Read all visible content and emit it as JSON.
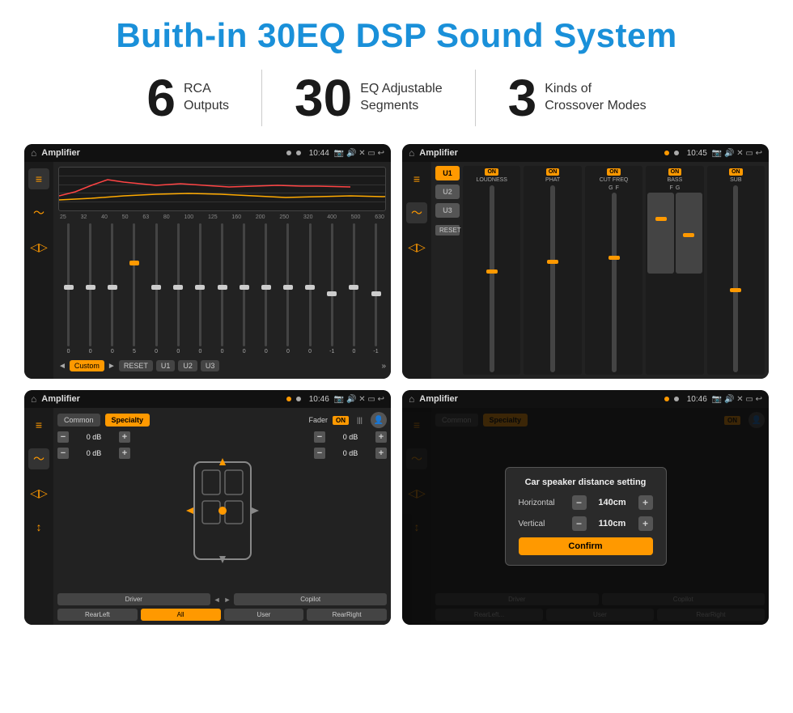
{
  "title": "Buith-in 30EQ DSP Sound System",
  "stats": [
    {
      "number": "6",
      "desc_line1": "RCA",
      "desc_line2": "Outputs"
    },
    {
      "number": "30",
      "desc_line1": "EQ Adjustable",
      "desc_line2": "Segments"
    },
    {
      "number": "3",
      "desc_line1": "Kinds of",
      "desc_line2": "Crossover Modes"
    }
  ],
  "screens": [
    {
      "id": "screen-eq",
      "app": "Amplifier",
      "time": "10:44",
      "eq": {
        "freqs": [
          "25",
          "32",
          "40",
          "50",
          "63",
          "80",
          "100",
          "125",
          "160",
          "200",
          "250",
          "320",
          "400",
          "500",
          "630"
        ],
        "values": [
          "0",
          "0",
          "0",
          "5",
          "0",
          "0",
          "0",
          "0",
          "0",
          "0",
          "0",
          "0",
          "-1",
          "0",
          "-1"
        ],
        "preset": "Custom",
        "buttons": [
          "RESET",
          "U1",
          "U2",
          "U3"
        ]
      }
    },
    {
      "id": "screen-amp",
      "app": "Amplifier",
      "time": "10:45",
      "channels": [
        "LOUDNESS",
        "PHAT",
        "CUT FREQ",
        "BASS",
        "SUB"
      ],
      "u_buttons": [
        "U1",
        "U2",
        "U3"
      ]
    },
    {
      "id": "screen-fader",
      "app": "Amplifier",
      "time": "10:46",
      "tabs": [
        "Common",
        "Specialty"
      ],
      "fader_label": "Fader",
      "db_values": [
        "0 dB",
        "0 dB",
        "0 dB",
        "0 dB"
      ],
      "bottom_buttons": [
        "Driver",
        "Copilot",
        "RearLeft",
        "All",
        "User",
        "RearRight"
      ]
    },
    {
      "id": "screen-dialog",
      "app": "Amplifier",
      "time": "10:46",
      "tabs": [
        "Common",
        "Specialty"
      ],
      "dialog": {
        "title": "Car speaker distance setting",
        "horizontal_label": "Horizontal",
        "horizontal_value": "140cm",
        "vertical_label": "Vertical",
        "vertical_value": "110cm",
        "confirm_label": "Confirm"
      },
      "bottom_buttons": [
        "Driver",
        "Copilot",
        "RearLeft",
        "All",
        "User",
        "RearRight"
      ]
    }
  ],
  "colors": {
    "accent": "#1a90d9",
    "orange": "#f90",
    "dark_bg": "#1a1a1a",
    "panel_bg": "#222"
  }
}
